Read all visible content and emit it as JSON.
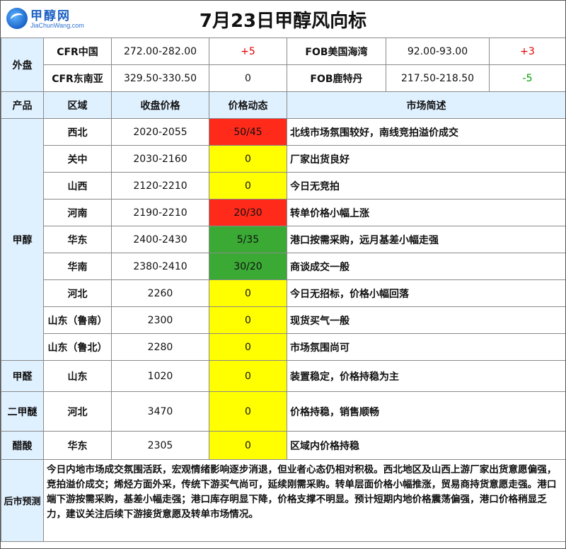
{
  "header": {
    "logo_text": "甲醇网",
    "logo_sub": "JiaChunWang.com",
    "title": "7月23日甲醇风向标"
  },
  "foreign": {
    "label": "外盘",
    "rows": [
      {
        "left_name": "CFR中国",
        "left_price": "272.00-282.00",
        "left_change": "+5",
        "right_name": "FOB美国海湾",
        "right_price": "92.00-93.00",
        "right_change": "+3"
      },
      {
        "left_name": "CFR东南亚",
        "left_price": "329.50-330.50",
        "left_change": "0",
        "right_name": "FOB鹿特丹",
        "right_price": "217.50-218.50",
        "right_change": "-5"
      }
    ]
  },
  "columns": {
    "product": "产品",
    "region": "区域",
    "price": "收盘价格",
    "change": "价格动态",
    "summary": "市场简述"
  },
  "methanol": {
    "label": "甲醇",
    "rows": [
      {
        "region": "西北",
        "price": "2020-2055",
        "change": "50/45",
        "summary": "北线市场氛围较好，南线竞拍溢价成交",
        "color": "#ff2a1a"
      },
      {
        "region": "关中",
        "price": "2030-2160",
        "change": "0",
        "summary": "厂家出货良好",
        "color": "#ffff00"
      },
      {
        "region": "山西",
        "price": "2120-2210",
        "change": "0",
        "summary": "今日无竞拍",
        "color": "#ffff00"
      },
      {
        "region": "河南",
        "price": "2190-2210",
        "change": "20/30",
        "summary": "转单价格小幅上涨",
        "color": "#ff2a1a"
      },
      {
        "region": "华东",
        "price": "2400-2430",
        "change": "5/35",
        "summary": "港口按需采购，远月基差小幅走强",
        "color": "#3aaa35"
      },
      {
        "region": "华南",
        "price": "2380-2410",
        "change": "30/20",
        "summary": "商谈成交一般",
        "color": "#3aaa35"
      },
      {
        "region": "河北",
        "price": "2260",
        "change": "0",
        "summary": "今日无招标，价格小幅回落",
        "color": "#ffff00"
      },
      {
        "region": "山东（鲁南）",
        "price": "2300",
        "change": "0",
        "summary": "现货买气一般",
        "color": "#ffff00"
      },
      {
        "region": "山东（鲁北）",
        "price": "2280",
        "change": "0",
        "summary": "市场氛围尚可",
        "color": "#ffff00"
      }
    ]
  },
  "formaldehyde": {
    "label": "甲醛",
    "region": "山东",
    "price": "1020",
    "change": "0",
    "summary": "装置稳定，价格持稳为主",
    "color": "#ffff00"
  },
  "dme": {
    "label": "二甲醚",
    "region": "河北",
    "price": "3470",
    "change": "0",
    "summary": "价格持稳，销售顺畅",
    "color": "#ffff00"
  },
  "acetic": {
    "label": "醋酸",
    "region": "华东",
    "price": "2305",
    "change": "0",
    "summary": "区域内价格持稳",
    "color": "#ffff00"
  },
  "forecast": {
    "label": "后市预测",
    "text": "今日内地市场成交氛围活跃，宏观情绪影响逐步消退，但业者心态仍相对积极。西北地区及山西上游厂家出货意愿偏强，竞拍溢价成交；烯烃方面外采，传统下游买气尚可，延续刚需采购。转单层面价格小幅推涨，贸易商持货意愿走强。港口端下游按需采购，基差小幅走强；港口库存明显下降，价格支撑不明显。预计短期内地价格震荡偏强，港口价格稍显乏力，建议关注后续下游接货意愿及转单市场情况。"
  }
}
